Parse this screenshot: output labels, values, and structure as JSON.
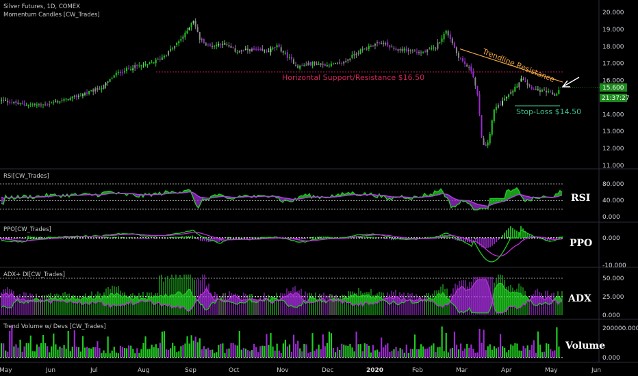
{
  "header": {
    "title": "Silver Futures, 1D, COMEX",
    "indicator": "Momentum Candles [CW_Trades]"
  },
  "colors": {
    "bull": "#22cc22",
    "bull_light": "#7fe07f",
    "bear": "#9b2bcf",
    "neutral": "#8a8a8a",
    "orange": "#f0a540",
    "support": "#d0265a",
    "stoploss": "#3cc08c",
    "accent_green": "#1e8a1e"
  },
  "price_pane": {
    "y_ticks": [
      "20.000",
      "19.000",
      "18.000",
      "17.000",
      "16.000",
      "15.000",
      "14.000",
      "13.000",
      "12.000",
      "11.000"
    ],
    "last_price": "15.600",
    "countdown": "21:37:27",
    "support_level": 16.5,
    "stop_level": 14.5,
    "annotations": {
      "support_label": "Horizontal Support/Resistance $16.50",
      "trendline_label": "Trendline Resistance",
      "stop_label": "Stop-Loss $14.50"
    }
  },
  "rsi_pane": {
    "title": "RSI[CW_Trades]",
    "label": "RSI",
    "y_ticks": [
      "80.000",
      "40.000",
      "0.000"
    ]
  },
  "ppo_pane": {
    "title": "PPO[CW_Trades]",
    "label": "PPO",
    "y_ticks": [
      "0.000",
      "-10.000"
    ]
  },
  "adx_pane": {
    "title": "ADX+ DI[CW_Trades]",
    "label": "ADX",
    "y_ticks": [
      "50.000",
      "25.000",
      "0.000"
    ]
  },
  "vol_pane": {
    "title": "Trend Volume w/ Devs [CW_Trades]",
    "label": "Volume",
    "y_ticks": [
      "200000.000",
      "0.000"
    ]
  },
  "x_axis": {
    "months": [
      "May",
      "Jun",
      "Jul",
      "Aug",
      "Sep",
      "Oct",
      "Nov",
      "Dec",
      "2020",
      "Feb",
      "Mar",
      "Apr",
      "May",
      "Jun"
    ]
  },
  "chart_data": {
    "type": "candlestick",
    "title": "Silver Futures, 1D, COMEX",
    "ylim": [
      11,
      20
    ],
    "approx_close_path": [
      {
        "month": "May",
        "close": 14.8
      },
      {
        "month": "Jun",
        "close": 14.6
      },
      {
        "month": "Jul",
        "close": 15.3
      },
      {
        "month": "Aug",
        "close": 16.8
      },
      {
        "month": "Sep",
        "close": 19.6
      },
      {
        "month": "Oct",
        "close": 17.8
      },
      {
        "month": "Nov",
        "close": 17.0
      },
      {
        "month": "Dec",
        "close": 16.9
      },
      {
        "month": "2020",
        "close": 18.0
      },
      {
        "month": "Feb",
        "close": 17.6
      },
      {
        "month": "Mar",
        "close": 16.5
      },
      {
        "month": "Mar",
        "close": 11.8
      },
      {
        "month": "Apr",
        "close": 15.2
      },
      {
        "month": "May",
        "close": 15.6
      }
    ]
  }
}
